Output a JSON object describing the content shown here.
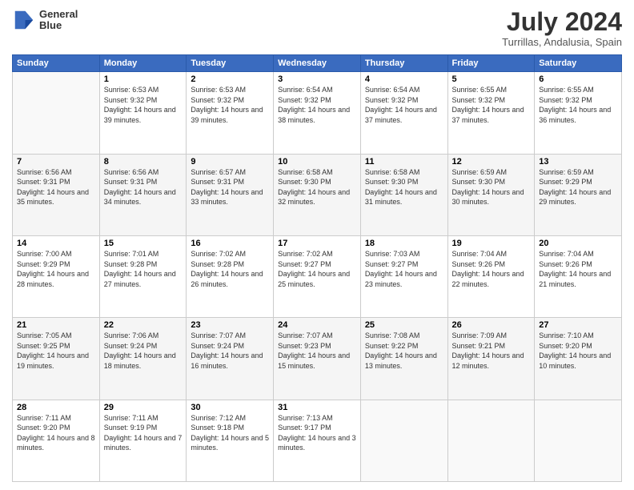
{
  "header": {
    "logo_line1": "General",
    "logo_line2": "Blue",
    "month_year": "July 2024",
    "location": "Turrillas, Andalusia, Spain"
  },
  "days_of_week": [
    "Sunday",
    "Monday",
    "Tuesday",
    "Wednesday",
    "Thursday",
    "Friday",
    "Saturday"
  ],
  "weeks": [
    [
      {
        "day": "",
        "sunrise": "",
        "sunset": "",
        "daylight": ""
      },
      {
        "day": "1",
        "sunrise": "Sunrise: 6:53 AM",
        "sunset": "Sunset: 9:32 PM",
        "daylight": "Daylight: 14 hours and 39 minutes."
      },
      {
        "day": "2",
        "sunrise": "Sunrise: 6:53 AM",
        "sunset": "Sunset: 9:32 PM",
        "daylight": "Daylight: 14 hours and 39 minutes."
      },
      {
        "day": "3",
        "sunrise": "Sunrise: 6:54 AM",
        "sunset": "Sunset: 9:32 PM",
        "daylight": "Daylight: 14 hours and 38 minutes."
      },
      {
        "day": "4",
        "sunrise": "Sunrise: 6:54 AM",
        "sunset": "Sunset: 9:32 PM",
        "daylight": "Daylight: 14 hours and 37 minutes."
      },
      {
        "day": "5",
        "sunrise": "Sunrise: 6:55 AM",
        "sunset": "Sunset: 9:32 PM",
        "daylight": "Daylight: 14 hours and 37 minutes."
      },
      {
        "day": "6",
        "sunrise": "Sunrise: 6:55 AM",
        "sunset": "Sunset: 9:32 PM",
        "daylight": "Daylight: 14 hours and 36 minutes."
      }
    ],
    [
      {
        "day": "7",
        "sunrise": "Sunrise: 6:56 AM",
        "sunset": "Sunset: 9:31 PM",
        "daylight": "Daylight: 14 hours and 35 minutes."
      },
      {
        "day": "8",
        "sunrise": "Sunrise: 6:56 AM",
        "sunset": "Sunset: 9:31 PM",
        "daylight": "Daylight: 14 hours and 34 minutes."
      },
      {
        "day": "9",
        "sunrise": "Sunrise: 6:57 AM",
        "sunset": "Sunset: 9:31 PM",
        "daylight": "Daylight: 14 hours and 33 minutes."
      },
      {
        "day": "10",
        "sunrise": "Sunrise: 6:58 AM",
        "sunset": "Sunset: 9:30 PM",
        "daylight": "Daylight: 14 hours and 32 minutes."
      },
      {
        "day": "11",
        "sunrise": "Sunrise: 6:58 AM",
        "sunset": "Sunset: 9:30 PM",
        "daylight": "Daylight: 14 hours and 31 minutes."
      },
      {
        "day": "12",
        "sunrise": "Sunrise: 6:59 AM",
        "sunset": "Sunset: 9:30 PM",
        "daylight": "Daylight: 14 hours and 30 minutes."
      },
      {
        "day": "13",
        "sunrise": "Sunrise: 6:59 AM",
        "sunset": "Sunset: 9:29 PM",
        "daylight": "Daylight: 14 hours and 29 minutes."
      }
    ],
    [
      {
        "day": "14",
        "sunrise": "Sunrise: 7:00 AM",
        "sunset": "Sunset: 9:29 PM",
        "daylight": "Daylight: 14 hours and 28 minutes."
      },
      {
        "day": "15",
        "sunrise": "Sunrise: 7:01 AM",
        "sunset": "Sunset: 9:28 PM",
        "daylight": "Daylight: 14 hours and 27 minutes."
      },
      {
        "day": "16",
        "sunrise": "Sunrise: 7:02 AM",
        "sunset": "Sunset: 9:28 PM",
        "daylight": "Daylight: 14 hours and 26 minutes."
      },
      {
        "day": "17",
        "sunrise": "Sunrise: 7:02 AM",
        "sunset": "Sunset: 9:27 PM",
        "daylight": "Daylight: 14 hours and 25 minutes."
      },
      {
        "day": "18",
        "sunrise": "Sunrise: 7:03 AM",
        "sunset": "Sunset: 9:27 PM",
        "daylight": "Daylight: 14 hours and 23 minutes."
      },
      {
        "day": "19",
        "sunrise": "Sunrise: 7:04 AM",
        "sunset": "Sunset: 9:26 PM",
        "daylight": "Daylight: 14 hours and 22 minutes."
      },
      {
        "day": "20",
        "sunrise": "Sunrise: 7:04 AM",
        "sunset": "Sunset: 9:26 PM",
        "daylight": "Daylight: 14 hours and 21 minutes."
      }
    ],
    [
      {
        "day": "21",
        "sunrise": "Sunrise: 7:05 AM",
        "sunset": "Sunset: 9:25 PM",
        "daylight": "Daylight: 14 hours and 19 minutes."
      },
      {
        "day": "22",
        "sunrise": "Sunrise: 7:06 AM",
        "sunset": "Sunset: 9:24 PM",
        "daylight": "Daylight: 14 hours and 18 minutes."
      },
      {
        "day": "23",
        "sunrise": "Sunrise: 7:07 AM",
        "sunset": "Sunset: 9:24 PM",
        "daylight": "Daylight: 14 hours and 16 minutes."
      },
      {
        "day": "24",
        "sunrise": "Sunrise: 7:07 AM",
        "sunset": "Sunset: 9:23 PM",
        "daylight": "Daylight: 14 hours and 15 minutes."
      },
      {
        "day": "25",
        "sunrise": "Sunrise: 7:08 AM",
        "sunset": "Sunset: 9:22 PM",
        "daylight": "Daylight: 14 hours and 13 minutes."
      },
      {
        "day": "26",
        "sunrise": "Sunrise: 7:09 AM",
        "sunset": "Sunset: 9:21 PM",
        "daylight": "Daylight: 14 hours and 12 minutes."
      },
      {
        "day": "27",
        "sunrise": "Sunrise: 7:10 AM",
        "sunset": "Sunset: 9:20 PM",
        "daylight": "Daylight: 14 hours and 10 minutes."
      }
    ],
    [
      {
        "day": "28",
        "sunrise": "Sunrise: 7:11 AM",
        "sunset": "Sunset: 9:20 PM",
        "daylight": "Daylight: 14 hours and 8 minutes."
      },
      {
        "day": "29",
        "sunrise": "Sunrise: 7:11 AM",
        "sunset": "Sunset: 9:19 PM",
        "daylight": "Daylight: 14 hours and 7 minutes."
      },
      {
        "day": "30",
        "sunrise": "Sunrise: 7:12 AM",
        "sunset": "Sunset: 9:18 PM",
        "daylight": "Daylight: 14 hours and 5 minutes."
      },
      {
        "day": "31",
        "sunrise": "Sunrise: 7:13 AM",
        "sunset": "Sunset: 9:17 PM",
        "daylight": "Daylight: 14 hours and 3 minutes."
      },
      {
        "day": "",
        "sunrise": "",
        "sunset": "",
        "daylight": ""
      },
      {
        "day": "",
        "sunrise": "",
        "sunset": "",
        "daylight": ""
      },
      {
        "day": "",
        "sunrise": "",
        "sunset": "",
        "daylight": ""
      }
    ]
  ]
}
